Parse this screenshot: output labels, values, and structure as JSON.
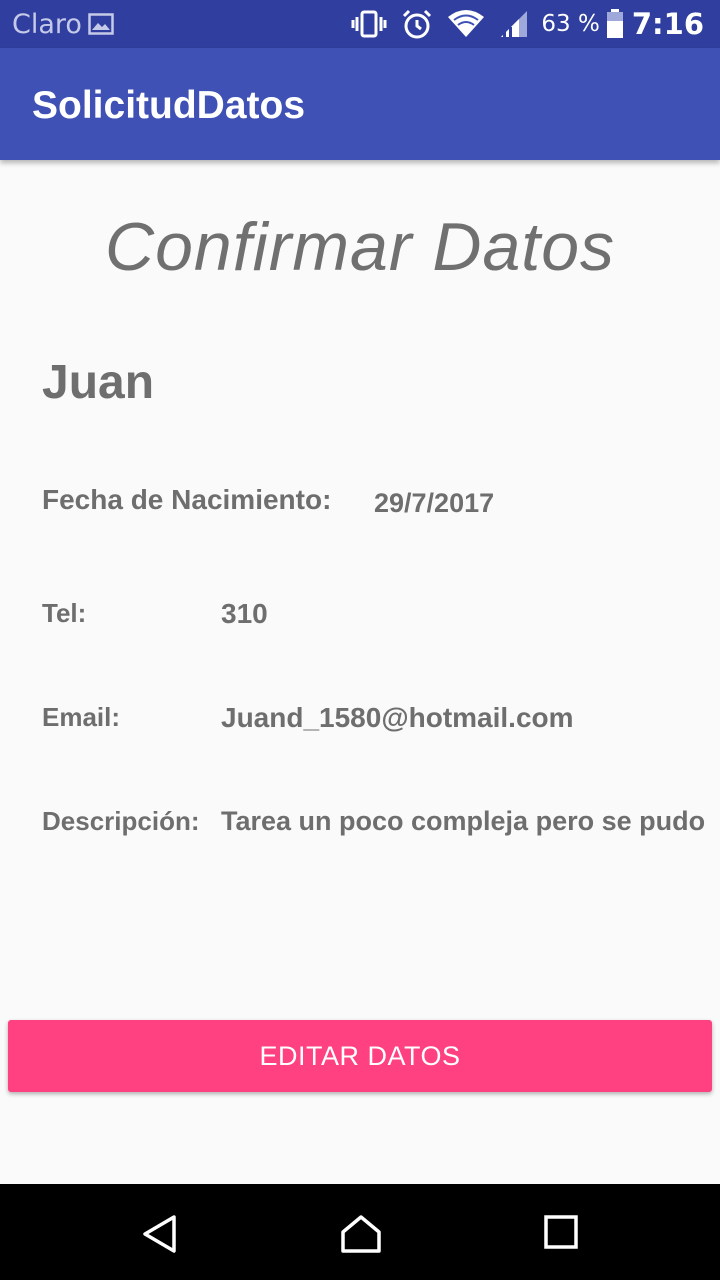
{
  "status_bar": {
    "carrier": "Claro",
    "battery_percent": "63 %",
    "time": "7:16",
    "icons": [
      "gallery-icon",
      "vibrate-icon",
      "alarm-icon",
      "wifi-icon",
      "signal-icon",
      "battery-icon"
    ]
  },
  "app_bar": {
    "title": "SolicitudDatos"
  },
  "content": {
    "heading": "Confirmar Datos",
    "name": "Juan",
    "birthdate_label": "Fecha de Nacimiento:",
    "birthdate_value": "29/7/2017",
    "phone_label": "Tel:",
    "phone_value": "310",
    "email_label": "Email:",
    "email_value": "Juand_1580@hotmail.com",
    "description_label": "Descripción:",
    "description_value": "Tarea un poco compleja pero se pudo"
  },
  "actions": {
    "edit_label": "EDITAR DATOS"
  },
  "colors": {
    "status_bar": "#303f9f",
    "app_bar": "#3f51b5",
    "accent": "#ff4081",
    "text": "#6e6e6e"
  },
  "navigation": {
    "icons": [
      "back-icon",
      "home-icon",
      "recents-icon"
    ]
  }
}
